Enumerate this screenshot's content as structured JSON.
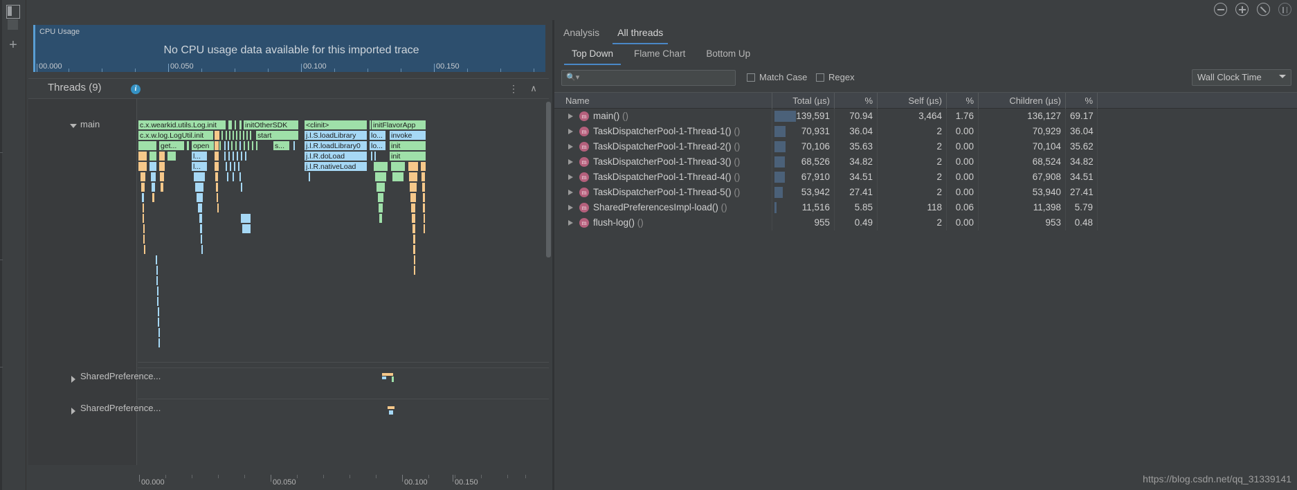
{
  "window": {
    "top_icons": [
      {
        "name": "zoom-out-icon",
        "glyph": "minus"
      },
      {
        "name": "zoom-in-icon",
        "glyph": "plus"
      },
      {
        "name": "reset-zoom-icon",
        "glyph": "slash"
      },
      {
        "name": "fit-to-screen-icon",
        "glyph": "brackets"
      }
    ]
  },
  "rail": {
    "items": [
      {
        "name": "layout-toggle-icon",
        "label": ""
      },
      {
        "name": "panel-icon",
        "label": ""
      },
      {
        "name": "add-icon",
        "label": "+"
      }
    ]
  },
  "cpu": {
    "label": "CPU Usage",
    "message": "No CPU usage data available for this imported trace",
    "ticks": [
      "00.000",
      "00.050",
      "00.100",
      "00.150"
    ]
  },
  "threads": {
    "title": "Threads (9)",
    "info_glyph": "i",
    "menu_glyph": "⋮",
    "collapse_glyph": "∧",
    "rows": [
      {
        "name": "main",
        "expanded": true
      },
      {
        "name": "SharedPreference...",
        "expanded": false
      },
      {
        "name": "SharedPreference...",
        "expanded": false
      }
    ],
    "timeline_ticks": [
      "00.000",
      "00.050",
      "00.100",
      "00.150"
    ],
    "flame_labels": [
      "c.x.wearkid.utils.Log.init",
      "initOtherSDK",
      "<clinit>",
      "initFlavorApp",
      "c.x.w.log.LogUtil.init",
      "start",
      "j.l.S.loadLibrary",
      "lo...",
      "invoke",
      "get...",
      "open",
      "s...",
      "j.l.R.loadLibrary0",
      "lo...",
      "init",
      "l...",
      "j.l.R.doLoad",
      "init",
      "l...",
      "j.l.R.nativeLoad",
      "init"
    ]
  },
  "right": {
    "primary_tabs": [
      {
        "label": "Analysis",
        "active": false
      },
      {
        "label": "All threads",
        "active": true
      }
    ],
    "secondary_tabs": [
      {
        "label": "Top Down",
        "active": true
      },
      {
        "label": "Flame Chart",
        "active": false
      },
      {
        "label": "Bottom Up",
        "active": false
      }
    ],
    "search": {
      "value": "",
      "placeholder": "",
      "icon": "search-icon"
    },
    "match_case": {
      "label": "Match Case",
      "checked": false
    },
    "regex": {
      "label": "Regex",
      "checked": false
    },
    "clock_select": {
      "value": "Wall Clock Time"
    },
    "table": {
      "columns": [
        "Name",
        "Total (µs)",
        "%",
        "Self (µs)",
        "%",
        "Children (µs)",
        "%"
      ],
      "rows": [
        {
          "name": "main()",
          "args": "()",
          "total": "139,591",
          "total_pct": "70.94",
          "self": "3,464",
          "self_pct": "1.76",
          "children": "136,127",
          "children_pct": "69.17",
          "barpct": 70.94
        },
        {
          "name": "TaskDispatcherPool-1-Thread-1()",
          "args": "()",
          "total": "70,931",
          "total_pct": "36.04",
          "self": "2",
          "self_pct": "0.00",
          "children": "70,929",
          "children_pct": "36.04",
          "barpct": 36.04
        },
        {
          "name": "TaskDispatcherPool-1-Thread-2()",
          "args": "()",
          "total": "70,106",
          "total_pct": "35.63",
          "self": "2",
          "self_pct": "0.00",
          "children": "70,104",
          "children_pct": "35.62",
          "barpct": 35.63
        },
        {
          "name": "TaskDispatcherPool-1-Thread-3()",
          "args": "()",
          "total": "68,526",
          "total_pct": "34.82",
          "self": "2",
          "self_pct": "0.00",
          "children": "68,524",
          "children_pct": "34.82",
          "barpct": 34.82
        },
        {
          "name": "TaskDispatcherPool-1-Thread-4()",
          "args": "()",
          "total": "67,910",
          "total_pct": "34.51",
          "self": "2",
          "self_pct": "0.00",
          "children": "67,908",
          "children_pct": "34.51",
          "barpct": 34.51
        },
        {
          "name": "TaskDispatcherPool-1-Thread-5()",
          "args": "()",
          "total": "53,942",
          "total_pct": "27.41",
          "self": "2",
          "self_pct": "0.00",
          "children": "53,940",
          "children_pct": "27.41",
          "barpct": 27.41
        },
        {
          "name": "SharedPreferencesImpl-load()",
          "args": "()",
          "total": "11,516",
          "total_pct": "5.85",
          "self": "118",
          "self_pct": "0.06",
          "children": "11,398",
          "children_pct": "5.79",
          "barpct": 5.85
        },
        {
          "name": "flush-log()",
          "args": "()",
          "total": "955",
          "total_pct": "0.49",
          "self": "2",
          "self_pct": "0.00",
          "children": "953",
          "children_pct": "0.48",
          "barpct": 0.49
        }
      ],
      "method_badge": "m"
    }
  },
  "watermark": "https://blog.csdn.net/qq_31339141",
  "colors": {
    "accent": "#4a88c7",
    "flame_green": "#9fe0a9",
    "flame_blue": "#a6d8f5",
    "flame_orange": "#f6c88a",
    "bar": "#4b6179",
    "cpu_bg": "#2d4f6e",
    "badge": "#b5607c"
  }
}
